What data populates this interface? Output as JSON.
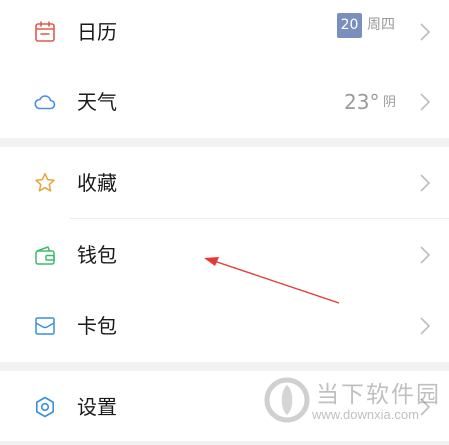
{
  "menu": {
    "calendar": {
      "label": "日历",
      "icon": "calendar-icon",
      "icon_color": "#e05a4f",
      "date": "20",
      "weekday": "周四"
    },
    "weather": {
      "label": "天气",
      "icon": "cloud-icon",
      "icon_color": "#4a8fe0",
      "temperature": "23°",
      "condition": "阴"
    },
    "favorites": {
      "label": "收藏",
      "icon": "star-icon",
      "icon_color": "#e8a33d"
    },
    "wallet": {
      "label": "钱包",
      "icon": "wallet-icon",
      "icon_color": "#3dbb6a"
    },
    "card_pack": {
      "label": "卡包",
      "icon": "card-icon",
      "icon_color": "#3a8fd9"
    },
    "settings": {
      "label": "设置",
      "icon": "gear-icon",
      "icon_color": "#3a8fd9"
    }
  },
  "watermark": {
    "title": "当下软件园",
    "url": "www.downxia.com"
  },
  "annotation_color": "#e53935"
}
